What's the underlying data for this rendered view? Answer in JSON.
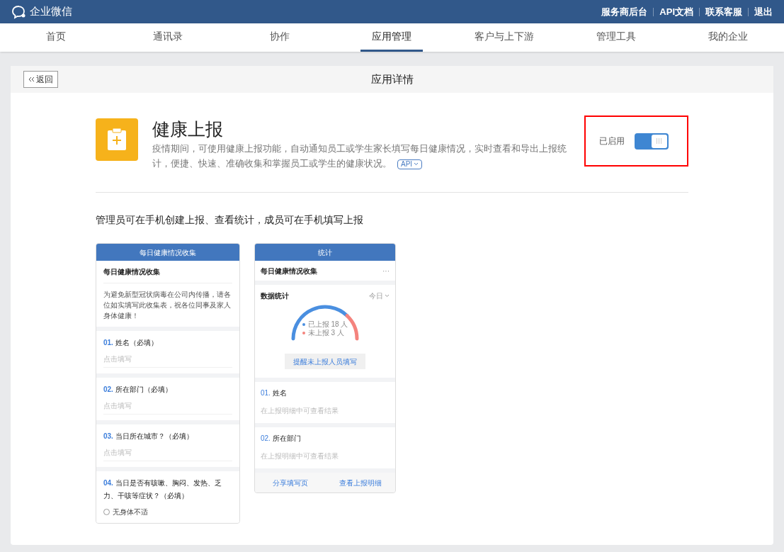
{
  "topbar": {
    "logo": "企业微信",
    "links": [
      "服务商后台",
      "API文档",
      "联系客服",
      "退出"
    ]
  },
  "nav": [
    {
      "label": "首页",
      "selected": false
    },
    {
      "label": "通讯录",
      "selected": false
    },
    {
      "label": "协作",
      "selected": false
    },
    {
      "label": "应用管理",
      "selected": true
    },
    {
      "label": "客户与上下游",
      "selected": false
    },
    {
      "label": "管理工具",
      "selected": false
    },
    {
      "label": "我的企业",
      "selected": false
    }
  ],
  "panel": {
    "back": "返回",
    "title": "应用详情"
  },
  "app": {
    "name": "健康上报",
    "description": "疫情期间，可使用健康上报功能，自动通知员工或学生家长填写每日健康情况，实时查看和导出上报统计，便捷、快速、准确收集和掌握员工或学生的健康状况。",
    "api_tag": "API",
    "status_label": "已启用",
    "enabled": true,
    "highlighted": true
  },
  "section_title": "管理员可在手机创建上报、查看统计，成员可在手机填写上报",
  "form_preview": {
    "header": "每日健康情况收集",
    "title": "每日健康情况收集",
    "intro": "为避免新型冠状病毒在公司内传播，请各位如实填写此收集表，祝各位同事及家人身体健康！",
    "questions": [
      {
        "kind": "text",
        "number": "01.",
        "text": "姓名（必填）",
        "placeholder": "点击填写"
      },
      {
        "kind": "text",
        "number": "02.",
        "text": "所在部门（必填）",
        "placeholder": "点击填写"
      },
      {
        "kind": "text",
        "number": "03.",
        "text": "当日所在城市？（必填）",
        "placeholder": "点击填写"
      },
      {
        "kind": "choice",
        "number": "04.",
        "text": "当日是否有咳嗽、胸闷、发热、乏力、干咳等症状？（必填）",
        "options": [
          {
            "label": "无身体不适",
            "selected": false
          }
        ]
      }
    ]
  },
  "stats_preview": {
    "header": "统计",
    "title": "每日健康情况收集",
    "more": "···",
    "section": "数据统计",
    "period": "今日",
    "legend": [
      {
        "label": "已上报 18 人",
        "color": "#4a8fe0"
      },
      {
        "label": "未上报 3 人",
        "color": "#f4837d"
      }
    ],
    "remind_button": "提醒未上报人员填写",
    "questions": [
      {
        "number": "01.",
        "text": "姓名",
        "hint": "在上报明细中可查看结果"
      },
      {
        "number": "02.",
        "text": "所在部门",
        "hint": "在上报明细中可查看结果"
      }
    ],
    "footer_links": [
      "分享填写页",
      "查看上报明细"
    ]
  }
}
